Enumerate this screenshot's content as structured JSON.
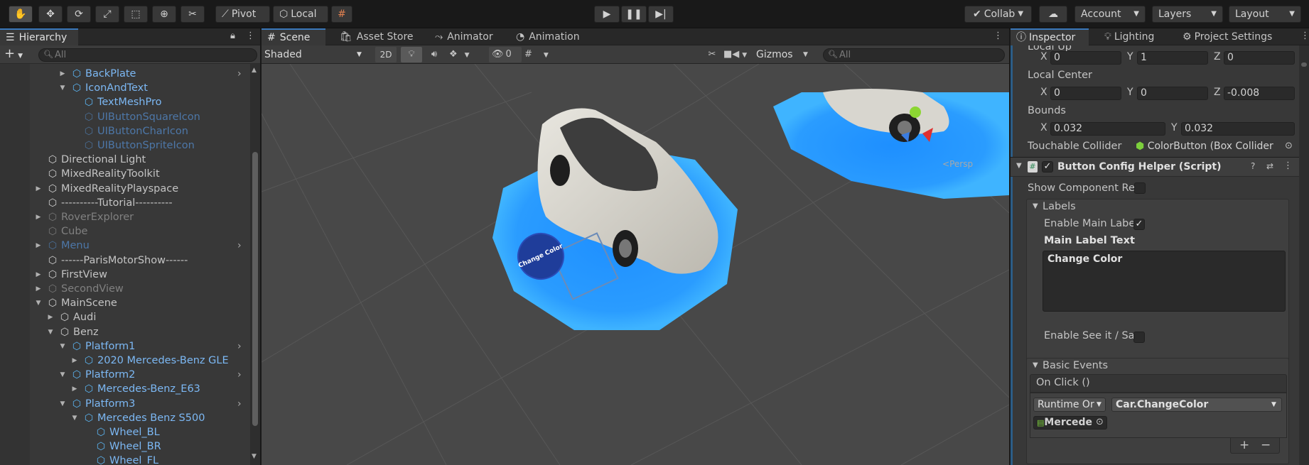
{
  "toolbar": {
    "pivot": "Pivot",
    "local": "Local",
    "collab": "Collab",
    "account": "Account",
    "layers": "Layers",
    "layout": "Layout"
  },
  "hierarchy": {
    "tab": "Hierarchy",
    "search_placeholder": "All",
    "items": [
      {
        "label": "BackPlate",
        "depth": 2,
        "arrow": "right",
        "style": "prefab",
        "more": true
      },
      {
        "label": "IconAndText",
        "depth": 2,
        "arrow": "down",
        "style": "prefab",
        "more": false
      },
      {
        "label": "TextMeshPro",
        "depth": 3,
        "arrow": "",
        "style": "prefab",
        "more": false
      },
      {
        "label": "UIButtonSquareIcon",
        "depth": 3,
        "arrow": "",
        "style": "dimprefab",
        "more": false
      },
      {
        "label": "UIButtonCharIcon",
        "depth": 3,
        "arrow": "",
        "style": "dimprefab",
        "more": false
      },
      {
        "label": "UIButtonSpriteIcon",
        "depth": 3,
        "arrow": "",
        "style": "dimprefab",
        "more": false
      },
      {
        "label": "Directional Light",
        "depth": 0,
        "arrow": "",
        "style": "normal",
        "more": false
      },
      {
        "label": "MixedRealityToolkit",
        "depth": 0,
        "arrow": "",
        "style": "normal",
        "more": false
      },
      {
        "label": "MixedRealityPlayspace",
        "depth": 0,
        "arrow": "right",
        "style": "normal",
        "more": false
      },
      {
        "label": "----------Tutorial----------",
        "depth": 0,
        "arrow": "",
        "style": "normal",
        "more": false
      },
      {
        "label": "RoverExplorer",
        "depth": 0,
        "arrow": "right",
        "style": "dim",
        "more": false
      },
      {
        "label": "Cube",
        "depth": 0,
        "arrow": "",
        "style": "dim",
        "more": false
      },
      {
        "label": "Menu",
        "depth": 0,
        "arrow": "right",
        "style": "dimprefab",
        "more": true
      },
      {
        "label": "------ParisMotorShow------",
        "depth": 0,
        "arrow": "",
        "style": "normal",
        "more": false
      },
      {
        "label": "FirstView",
        "depth": 0,
        "arrow": "right",
        "style": "normal",
        "more": false
      },
      {
        "label": "SecondView",
        "depth": 0,
        "arrow": "right",
        "style": "dim",
        "more": false
      },
      {
        "label": "MainScene",
        "depth": 0,
        "arrow": "down",
        "style": "normal",
        "more": false
      },
      {
        "label": "Audi",
        "depth": 1,
        "arrow": "right",
        "style": "normal",
        "more": false
      },
      {
        "label": "Benz",
        "depth": 1,
        "arrow": "down",
        "style": "normal",
        "more": false
      },
      {
        "label": "Platform1",
        "depth": 2,
        "arrow": "down",
        "style": "prefab",
        "more": true
      },
      {
        "label": "2020 Mercedes-Benz GLE",
        "depth": 3,
        "arrow": "right",
        "style": "prefab",
        "more": false
      },
      {
        "label": "Platform2",
        "depth": 2,
        "arrow": "down",
        "style": "prefab",
        "more": true
      },
      {
        "label": "Mercedes-Benz_E63",
        "depth": 3,
        "arrow": "right",
        "style": "prefab",
        "more": false
      },
      {
        "label": "Platform3",
        "depth": 2,
        "arrow": "down",
        "style": "prefab",
        "more": true
      },
      {
        "label": "Mercedes Benz S500",
        "depth": 3,
        "arrow": "down",
        "style": "prefab",
        "more": false
      },
      {
        "label": "Wheel_BL",
        "depth": 4,
        "arrow": "",
        "style": "prefab",
        "more": false
      },
      {
        "label": "Wheel_BR",
        "depth": 4,
        "arrow": "",
        "style": "prefab",
        "more": false
      },
      {
        "label": "Wheel_FL",
        "depth": 4,
        "arrow": "",
        "style": "prefab",
        "more": false
      }
    ]
  },
  "scene": {
    "tabs": [
      "Scene",
      "Asset Store",
      "Animator",
      "Animation"
    ],
    "shading": "Shaded",
    "mode_2d": "2D",
    "hidden_count": "0",
    "gizmos": "Gizmos",
    "search_placeholder": "All",
    "persp": "Persp",
    "button_text": "Change Color"
  },
  "inspector": {
    "tabs": [
      "Inspector",
      "Lighting",
      "Project Settings"
    ],
    "local_up": {
      "label": "Local Up",
      "x": "0",
      "y": "1",
      "z": "0"
    },
    "local_center": {
      "label": "Local Center",
      "x": "0",
      "y": "0",
      "z": "-0.008"
    },
    "bounds": {
      "label": "Bounds",
      "x": "0.032",
      "y": "0.032"
    },
    "touchable_collider": {
      "label": "Touchable Collider",
      "value": "ColorButton (Box Collider"
    },
    "component_title": "Button Config Helper (Script)",
    "show_component_refs": "Show Component Re",
    "labels_header": "Labels",
    "enable_main_label": "Enable Main Labe",
    "main_label_text_title": "Main Label Text",
    "main_label_text": "Change Color",
    "enable_see_it": "Enable See it / Say",
    "basic_events_header": "Basic Events",
    "on_click": "On Click ()",
    "runtime_mode": "Runtime Or",
    "function": "Car.ChangeColor",
    "target_object": "Mercede",
    "axis": {
      "x": "X",
      "y": "Y",
      "z": "Z"
    }
  }
}
